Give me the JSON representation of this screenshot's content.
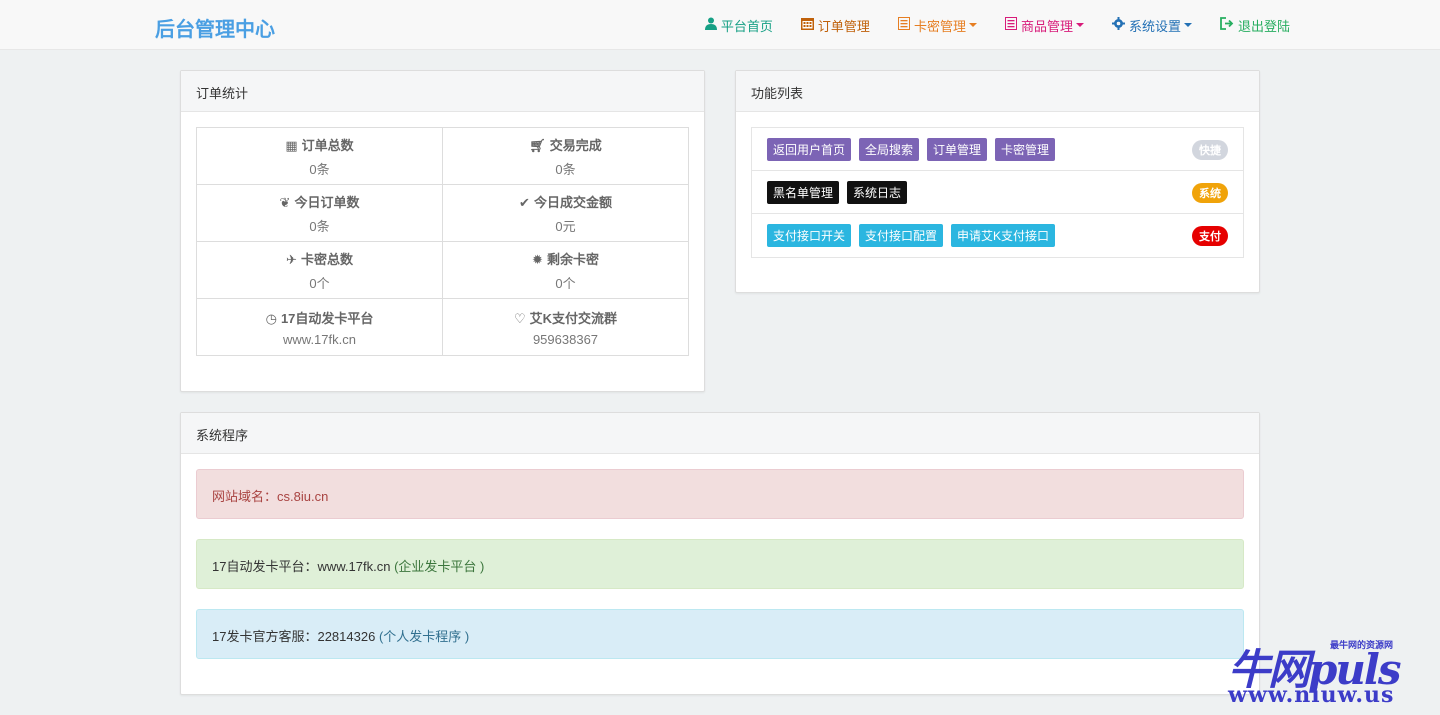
{
  "brand": "后台管理中心",
  "nav": [
    {
      "label": "平台首页",
      "icon": "user-icon",
      "color": "#16a085",
      "dropdown": false
    },
    {
      "label": "订单管理",
      "icon": "calendar-icon",
      "color": "#c0610a",
      "dropdown": false
    },
    {
      "label": "卡密管理",
      "icon": "list-icon",
      "color": "#e67e22",
      "dropdown": true
    },
    {
      "label": "商品管理",
      "icon": "list-alt-icon",
      "color": "#d81b7a",
      "dropdown": true
    },
    {
      "label": "系统设置",
      "icon": "gear-icon",
      "color": "#2471b5",
      "dropdown": true
    },
    {
      "label": "退出登陆",
      "icon": "logout-icon",
      "color": "#27ae60",
      "dropdown": false
    }
  ],
  "orders_panel": {
    "title": "订单统计",
    "stats": [
      {
        "label": "订单总数",
        "value": "0条",
        "icon": "grid-icon"
      },
      {
        "label": "交易完成",
        "value": "0条",
        "icon": "cart-icon"
      },
      {
        "label": "今日订单数",
        "value": "0条",
        "icon": "leaf-icon"
      },
      {
        "label": "今日成交金额",
        "value": "0元",
        "icon": "check-icon"
      },
      {
        "label": "卡密总数",
        "value": "0个",
        "icon": "plane-icon"
      },
      {
        "label": "剩余卡密",
        "value": "0个",
        "icon": "certificate-icon"
      },
      {
        "label": "17自动发卡平台",
        "value": "www.17fk.cn",
        "icon": "dashboard-icon"
      },
      {
        "label": "艾K支付交流群",
        "value": "959638367",
        "icon": "heart-icon"
      }
    ]
  },
  "func_panel": {
    "title": "功能列表",
    "rows": [
      {
        "badge": "快捷",
        "badge_color": "#d2d6de",
        "tags": [
          {
            "label": "返回用户首页",
            "color": "#7c64b5"
          },
          {
            "label": "全局搜索",
            "color": "#7c64b5"
          },
          {
            "label": "订单管理",
            "color": "#7c64b5"
          },
          {
            "label": "卡密管理",
            "color": "#7c64b5"
          }
        ]
      },
      {
        "badge": "系统",
        "badge_color": "#f0a30a",
        "tags": [
          {
            "label": "黑名单管理",
            "color": "#111111"
          },
          {
            "label": "系统日志",
            "color": "#111111"
          }
        ]
      },
      {
        "badge": "支付",
        "badge_color": "#e60000",
        "tags": [
          {
            "label": "支付接口开关",
            "color": "#2bb6e0"
          },
          {
            "label": "支付接口配置",
            "color": "#2bb6e0"
          },
          {
            "label": "申请艾K支付接口",
            "color": "#2bb6e0"
          }
        ]
      }
    ]
  },
  "system_panel": {
    "title": "系统程序",
    "alerts": [
      {
        "label": "网站域名：",
        "value": "cs.8iu.cn",
        "note": "",
        "type": "danger"
      },
      {
        "label": "17自动发卡平台：",
        "value": "www.17fk.cn",
        "note": "(企业发卡平台 )",
        "type": "success"
      },
      {
        "label": "17发卡官方客服：",
        "value": "22814326",
        "note": "(个人发卡程序 )",
        "type": "info"
      }
    ]
  },
  "watermark": {
    "big": "牛网puls",
    "small": "最牛网的资源网",
    "url": "www.niuw.us"
  }
}
